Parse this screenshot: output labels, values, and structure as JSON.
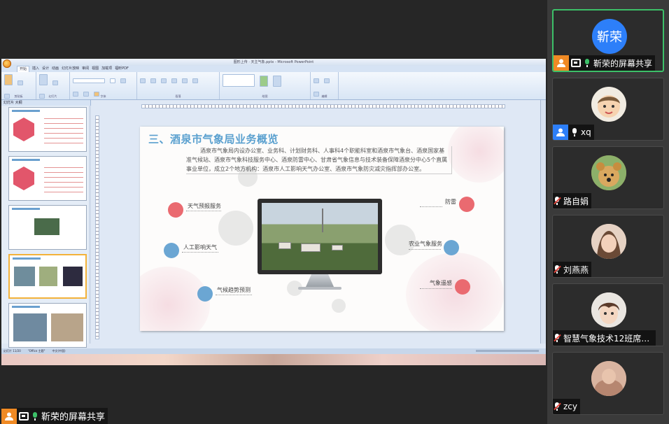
{
  "share": {
    "title_bar": "图形上传 · 天主气象.pptx - Microsoft PowerPoint",
    "ribbon_tabs": [
      "开始",
      "插入",
      "设计",
      "动画",
      "幻灯片放映",
      "审阅",
      "视图",
      "加载项",
      "福昕PDF"
    ],
    "ribbon_groups": [
      "剪贴板",
      "幻灯片",
      "字体",
      "段落",
      "绘图",
      "编辑"
    ],
    "thumb_tab": "幻灯片 大纲",
    "slide_numbers": [
      "5",
      "6",
      "7",
      "8",
      "9"
    ],
    "status": [
      "幻灯片 11/20",
      "\"Office 主题\"",
      "中文(中国)"
    ],
    "label": "靳荣的屏幕共享"
  },
  "slide": {
    "title": "三、酒泉市气象局业务概览",
    "paragraph": "酒泉市气象局内设办公室、业务科、计划财务科、人事科4个职能科室和酒泉市气象台、酒泉国家基准气候站、酒泉市气象科技服务中心、酒泉防雷中心、甘肃省气象信息与技术装备保障酒泉分中心5个直属事业单位，成立2个地方机构：酒泉市人工影响天气办公室、酒泉市气象防灾减灾指挥部办公室。",
    "services": [
      {
        "label": "天气预报服务",
        "color": "#ea6a70"
      },
      {
        "label": "人工影响天气",
        "color": "#6ba6d3"
      },
      {
        "label": "气候趋势预测",
        "color": "#6ba6d3"
      },
      {
        "label": "防雷",
        "color": "#ea6a70"
      },
      {
        "label": "农业气象服务",
        "color": "#6ba6d3"
      },
      {
        "label": "气象遥感",
        "color": "#ea6a70"
      }
    ]
  },
  "participants": [
    {
      "name": "靳荣的屏幕共享",
      "avatar_text": "靳荣",
      "mic": "on",
      "badge": "orange",
      "sharing": true,
      "active": true
    },
    {
      "name": "xq",
      "mic": "plain",
      "badge": "blue",
      "sharing": false,
      "active": false,
      "avatar_color": "#f1ece2"
    },
    {
      "name": "路自娟",
      "mic": "muted",
      "badge": "none",
      "sharing": false,
      "active": false,
      "avatar_color": "#c79a52"
    },
    {
      "name": "刘燕燕",
      "mic": "muted",
      "badge": "none",
      "sharing": false,
      "active": false,
      "avatar_color": "#d8b8a6"
    },
    {
      "name": "智慧气象技术12班席gu...",
      "mic": "muted",
      "badge": "none",
      "sharing": false,
      "active": false,
      "avatar_color": "#e9e2dc"
    },
    {
      "name": "zcy",
      "mic": "muted",
      "badge": "none",
      "sharing": false,
      "active": false,
      "avatar_color": "#c99c85"
    }
  ],
  "colors": {
    "accent_green": "#3cc068",
    "accent_blue": "#2d7ff9",
    "accent_orange": "#f08a24",
    "slide_title": "#5aa0cf"
  }
}
